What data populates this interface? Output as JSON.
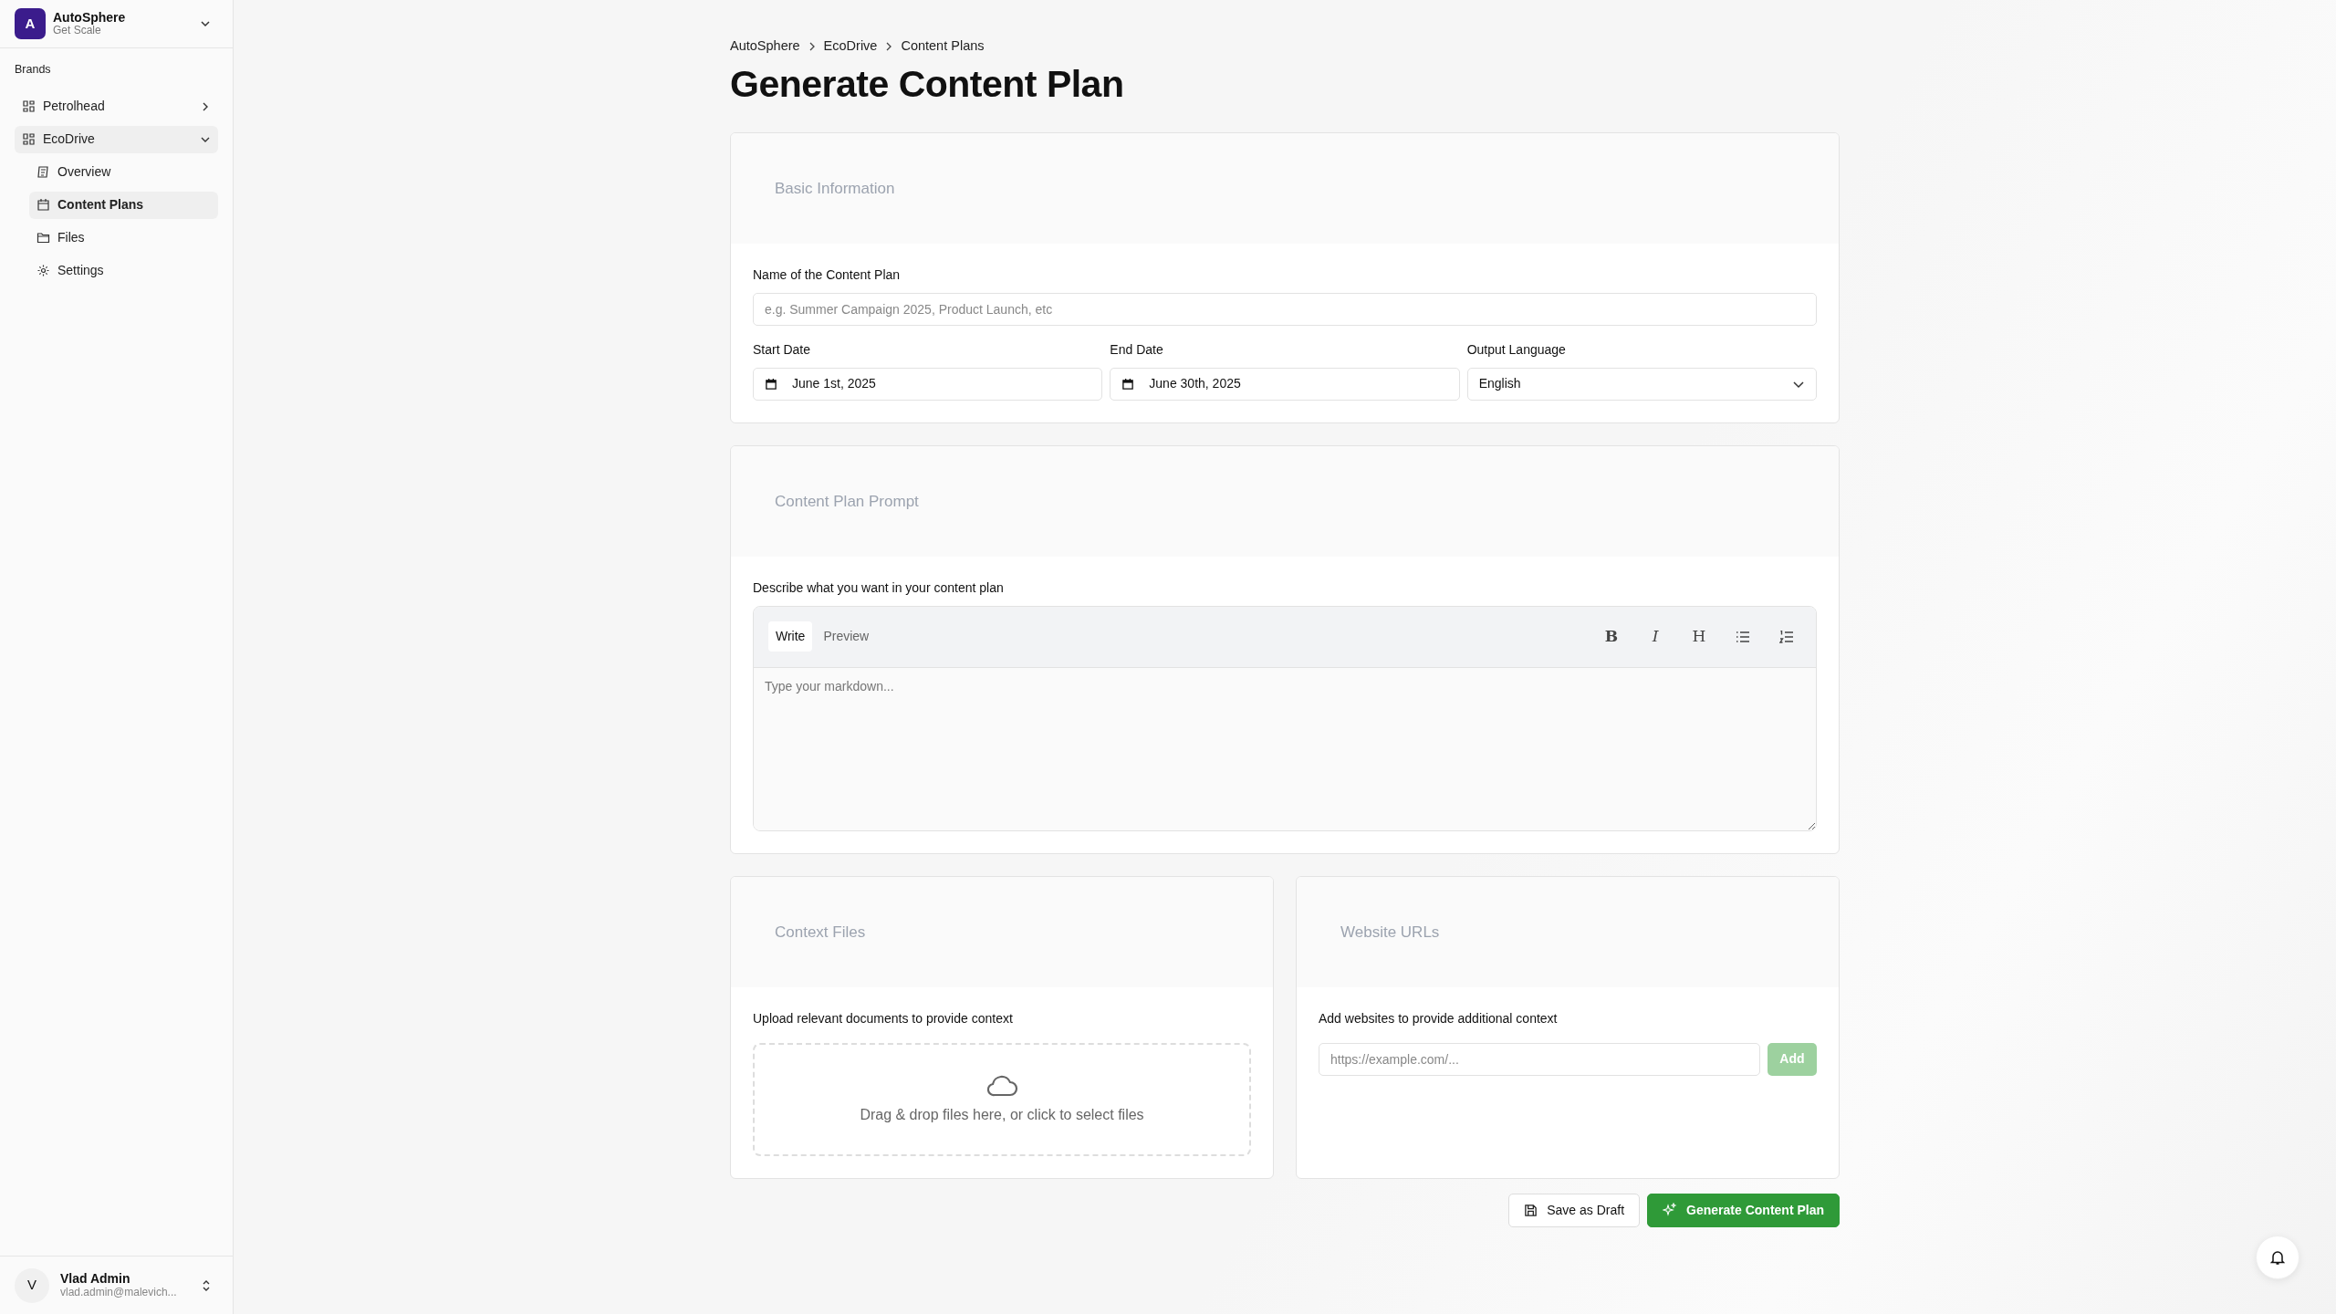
{
  "workspace": {
    "initial": "A",
    "name": "AutoSphere",
    "plan": "Get Scale"
  },
  "sidebar": {
    "section_label": "Brands",
    "items": [
      {
        "label": "Petrolhead",
        "expanded": false
      },
      {
        "label": "EcoDrive",
        "expanded": true,
        "children": [
          {
            "kind": "overview",
            "label": "Overview",
            "selected": false
          },
          {
            "kind": "calendar",
            "label": "Content Plans",
            "selected": true
          },
          {
            "kind": "folder",
            "label": "Files",
            "selected": false
          },
          {
            "kind": "gear",
            "label": "Settings",
            "selected": false
          }
        ]
      }
    ]
  },
  "user": {
    "initial": "V",
    "name": "Vlad Admin",
    "email": "vlad.admin@malevich..."
  },
  "breadcrumb": [
    "AutoSphere",
    "EcoDrive",
    "Content Plans"
  ],
  "title": "Generate Content Plan",
  "basic_info": {
    "title": "Basic Information",
    "name_field": {
      "label": "Name of the Content Plan",
      "placeholder": "e.g. Summer Campaign 2025, Product Launch, etc"
    },
    "start_date": {
      "label": "Start Date",
      "value": "June 1st, 2025"
    },
    "end_date": {
      "label": "End Date",
      "value": "June 30th, 2025"
    },
    "language": {
      "label": "Output Language",
      "value": "English"
    }
  },
  "prompt": {
    "title": "Content Plan Prompt",
    "label": "Describe what you want in your content plan",
    "tabs": [
      {
        "label": "Write",
        "selected": true
      },
      {
        "label": "Preview",
        "selected": false
      }
    ],
    "toolbar": [
      {
        "kind": "bold",
        "label": "B"
      },
      {
        "kind": "italic",
        "label": "I"
      },
      {
        "kind": "heading",
        "label": "H"
      },
      {
        "kind": "bullet-list"
      },
      {
        "kind": "numbered-list"
      }
    ],
    "placeholder": "Type your markdown..."
  },
  "context_files": {
    "title": "Context Files",
    "label": "Upload relevant documents to provide context",
    "dropzone_text": "Drag & drop files here, or click to select files"
  },
  "website_urls": {
    "title": "Website URLs",
    "label": "Add websites to provide additional context",
    "placeholder": "https://example.com/...",
    "add_button": {
      "label": "Add",
      "disabled": true
    }
  },
  "actions": {
    "save_draft": "Save as Draft",
    "generate": "Generate Content Plan"
  }
}
